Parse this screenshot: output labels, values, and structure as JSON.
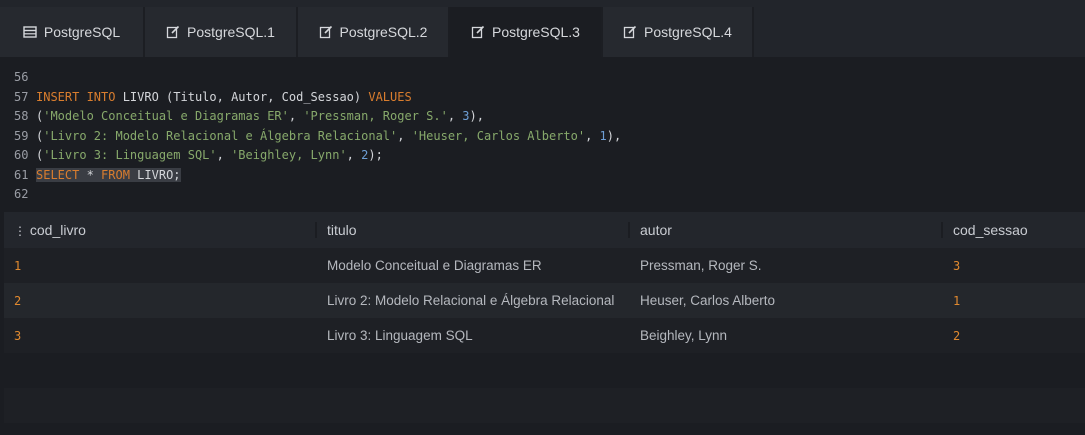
{
  "tabs": [
    {
      "label": "PostgreSQL",
      "icon": "table-icon",
      "active": false
    },
    {
      "label": "PostgreSQL.1",
      "icon": "edit-icon",
      "active": false
    },
    {
      "label": "PostgreSQL.2",
      "icon": "edit-icon",
      "active": false
    },
    {
      "label": "PostgreSQL.3",
      "icon": "edit-icon",
      "active": true
    },
    {
      "label": "PostgreSQL.4",
      "icon": "edit-icon",
      "active": false
    }
  ],
  "editor": {
    "lines": [
      {
        "n": "56",
        "tokens": []
      },
      {
        "n": "57",
        "tokens": [
          [
            "kw",
            "INSERT INTO"
          ],
          [
            "plain",
            " LIVRO (Titulo, Autor, Cod_Sessao) "
          ],
          [
            "kw",
            "VALUES"
          ]
        ]
      },
      {
        "n": "58",
        "tokens": [
          [
            "plain",
            "("
          ],
          [
            "str",
            "'Modelo Conceitual e Diagramas ER'"
          ],
          [
            "plain",
            ", "
          ],
          [
            "str",
            "'Pressman, Roger S.'"
          ],
          [
            "plain",
            ", "
          ],
          [
            "num",
            "3"
          ],
          [
            "plain",
            "),"
          ]
        ]
      },
      {
        "n": "59",
        "tokens": [
          [
            "plain",
            "("
          ],
          [
            "str",
            "'Livro 2: Modelo Relacional e Álgebra Relacional'"
          ],
          [
            "plain",
            ", "
          ],
          [
            "str",
            "'Heuser, Carlos Alberto'"
          ],
          [
            "plain",
            ", "
          ],
          [
            "num",
            "1"
          ],
          [
            "plain",
            "),"
          ]
        ]
      },
      {
        "n": "60",
        "tokens": [
          [
            "plain",
            "("
          ],
          [
            "str",
            "'Livro 3: Linguagem SQL'"
          ],
          [
            "plain",
            ", "
          ],
          [
            "str",
            "'Beighley, Lynn'"
          ],
          [
            "plain",
            ", "
          ],
          [
            "num",
            "2"
          ],
          [
            "plain",
            ");"
          ]
        ]
      },
      {
        "n": "61",
        "tokens": [
          [
            "kw",
            "SELECT"
          ],
          [
            "plain",
            " * "
          ],
          [
            "kw",
            "FROM"
          ],
          [
            "plain",
            " LIVRO;"
          ]
        ],
        "highlight": true
      },
      {
        "n": "62",
        "tokens": []
      }
    ]
  },
  "results": {
    "columns": [
      "cod_livro",
      "titulo",
      "autor",
      "cod_sessao"
    ],
    "rows": [
      [
        "1",
        "Modelo Conceitual e Diagramas ER",
        "Pressman, Roger S.",
        "3"
      ],
      [
        "2",
        "Livro 2: Modelo Relacional e Álgebra Relacional",
        "Heuser, Carlos Alberto",
        "1"
      ],
      [
        "3",
        "Livro 3: Linguagem SQL",
        "Beighley, Lynn",
        "2"
      ]
    ]
  },
  "colors": {
    "keyword": "#d97d2e",
    "string": "#87a96b",
    "number": "#6e9fd6",
    "result_number": "#e0892f"
  }
}
